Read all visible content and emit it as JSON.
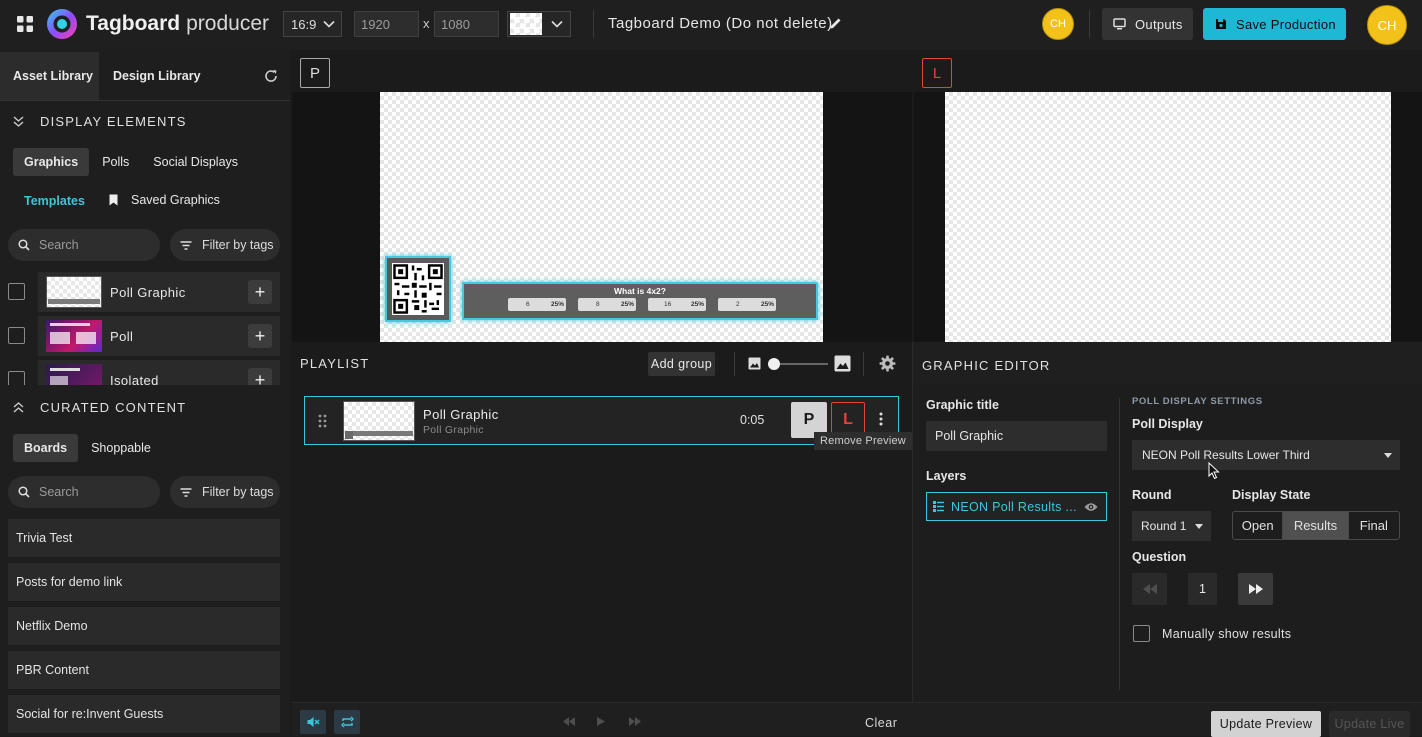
{
  "app": {
    "name_bold": "Tagboard",
    "name_light": "producer"
  },
  "toolbar": {
    "aspect_ratio": "16:9",
    "width": "1920",
    "height": "1080",
    "times": "x",
    "production_title": "Tagboard Demo (Do not delete)",
    "avatar_initials": "CH",
    "outputs_label": "Outputs",
    "save_label": "Save Production",
    "accent": "#1fb8d4",
    "avatar_color": "#f2c21b"
  },
  "library": {
    "tabs": [
      "Asset Library",
      "Design Library"
    ],
    "display_elements": {
      "title": "DISPLAY ELEMENTS",
      "tabs": [
        "Graphics",
        "Polls",
        "Social Displays"
      ],
      "subtabs": [
        "Templates",
        "Saved Graphics"
      ],
      "search_placeholder": "Search",
      "filter_label": "Filter by tags",
      "items": [
        {
          "label": "Poll Graphic"
        },
        {
          "label": "Poll"
        },
        {
          "label": "Isolated"
        }
      ]
    },
    "curated": {
      "title": "CURATED CONTENT",
      "tabs": [
        "Boards",
        "Shoppable"
      ],
      "search_placeholder": "Search",
      "filter_label": "Filter by tags",
      "boards": [
        "Trivia Test",
        "Posts for demo link",
        "Netflix Demo",
        "PBR Content",
        "Social for re:Invent Guests"
      ]
    }
  },
  "preview": {
    "badge": "P",
    "poll_question": "What is 4x2?",
    "options": [
      {
        "answer": "6",
        "percent": "25%"
      },
      {
        "answer": "8",
        "percent": "25%"
      },
      {
        "answer": "16",
        "percent": "25%"
      },
      {
        "answer": "2",
        "percent": "25%"
      }
    ]
  },
  "live": {
    "badge": "L",
    "badge_color": "#e0453a"
  },
  "playlist": {
    "title": "PLAYLIST",
    "add_group_label": "Add group",
    "item": {
      "title": "Poll Graphic",
      "subtitle": "Poll Graphic",
      "duration": "0:05",
      "preview_btn": "P",
      "live_btn": "L",
      "tooltip": "Remove Preview"
    }
  },
  "editor": {
    "title": "GRAPHIC EDITOR",
    "graphic_title_label": "Graphic title",
    "graphic_title_value": "Poll Graphic",
    "layers_label": "Layers",
    "layer_name": "NEON Poll Results ...",
    "settings_heading": "POLL DISPLAY SETTINGS",
    "poll_display_label": "Poll Display",
    "poll_display_value": "NEON Poll Results Lower Third",
    "round_label": "Round",
    "round_value": "Round 1",
    "display_state_label": "Display State",
    "states": [
      "Open",
      "Results",
      "Final"
    ],
    "active_state": "Results",
    "question_label": "Question",
    "question_number": "1",
    "manual_label": "Manually show results"
  },
  "footer": {
    "clear_label": "Clear",
    "update_preview_label": "Update Preview",
    "update_live_label": "Update Live"
  }
}
